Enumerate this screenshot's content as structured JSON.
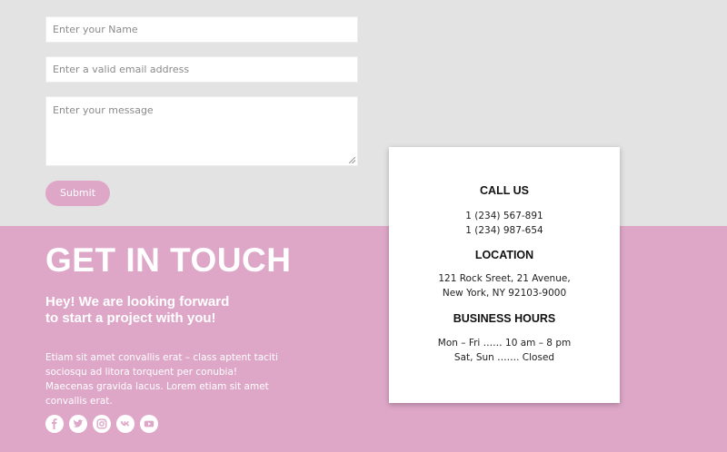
{
  "form": {
    "name_placeholder": "Enter your Name",
    "email_placeholder": "Enter a valid email address",
    "message_placeholder": "Enter your message",
    "submit_label": "Submit"
  },
  "hero": {
    "heading": "GET IN TOUCH",
    "subheading_line1": "Hey! We are looking forward",
    "subheading_line2": "to start a project with you!",
    "body": "Etiam sit amet convallis erat – class aptent taciti sociosqu ad litora torquent per conubia! Maecenas gravida lacus. Lorem etiam sit amet convallis erat."
  },
  "social": [
    "facebook-icon",
    "twitter-icon",
    "instagram-icon",
    "vk-icon",
    "youtube-icon"
  ],
  "contact_card": {
    "call_title": "CALL US",
    "phone1": "1 (234) 567-891",
    "phone2": "1 (234) 987-654",
    "location_title": "LOCATION",
    "address1": "121 Rock Sreet, 21 Avenue,",
    "address2": "New York, NY 92103-9000",
    "hours_title": "BUSINESS HOURS",
    "hours1": "Mon – Fri …… 10 am – 8 pm",
    "hours2": "Sat, Sun ……. Closed"
  },
  "colors": {
    "accent_pink": "#dea7c8",
    "page_gray": "#e3e3e3",
    "card_bg": "#ffffff"
  }
}
